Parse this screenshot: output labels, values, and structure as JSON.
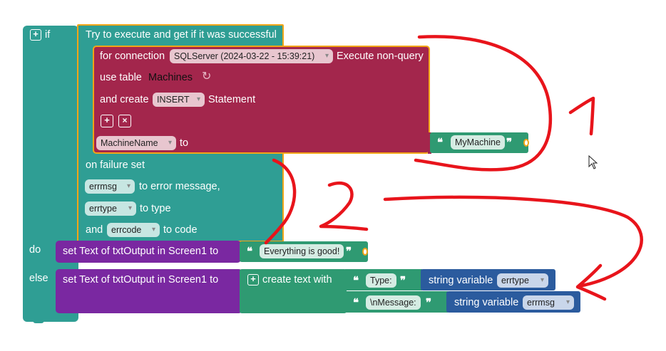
{
  "if_block": {
    "if_label": "if",
    "do_label": "do",
    "else_label": "else"
  },
  "try_block": {
    "title": "Try to execute and get if it was successful",
    "on_failure": "on failure set",
    "errmsg_var": "errmsg",
    "errmsg_target": "to error message,",
    "errtype_var": "errtype",
    "errtype_target": "to type",
    "and_label": "and",
    "errcode_var": "errcode",
    "errcode_target": "to code"
  },
  "sql_block": {
    "for_connection": "for connection",
    "connection_value": "SQLServer (2024-03-22 - 15:39:21)",
    "execute_label": "Execute non-query",
    "use_table": "use table",
    "table_name": "Machines",
    "and_create": "and create",
    "statement_type": "INSERT",
    "statement_label": "Statement",
    "column_name": "MachineName",
    "to_label": "to",
    "column_value": "MyMachine"
  },
  "do_block": {
    "label": "set Text of txtOutput in Screen1 to",
    "value": "Everything is good!"
  },
  "else_block": {
    "label": "set Text of txtOutput in Screen1 to",
    "create_text": "create text with",
    "item1_text": "Type:",
    "item1_var_label": "string variable",
    "item1_var": "errtype",
    "item2_text": "\\nMessage:",
    "item2_var_label": "string variable",
    "item2_var": "errmsg"
  },
  "annotations": {
    "number_1": "1",
    "number_2": "2",
    "color": "#e8141b"
  },
  "quote_open": "❝",
  "quote_close": "❞"
}
